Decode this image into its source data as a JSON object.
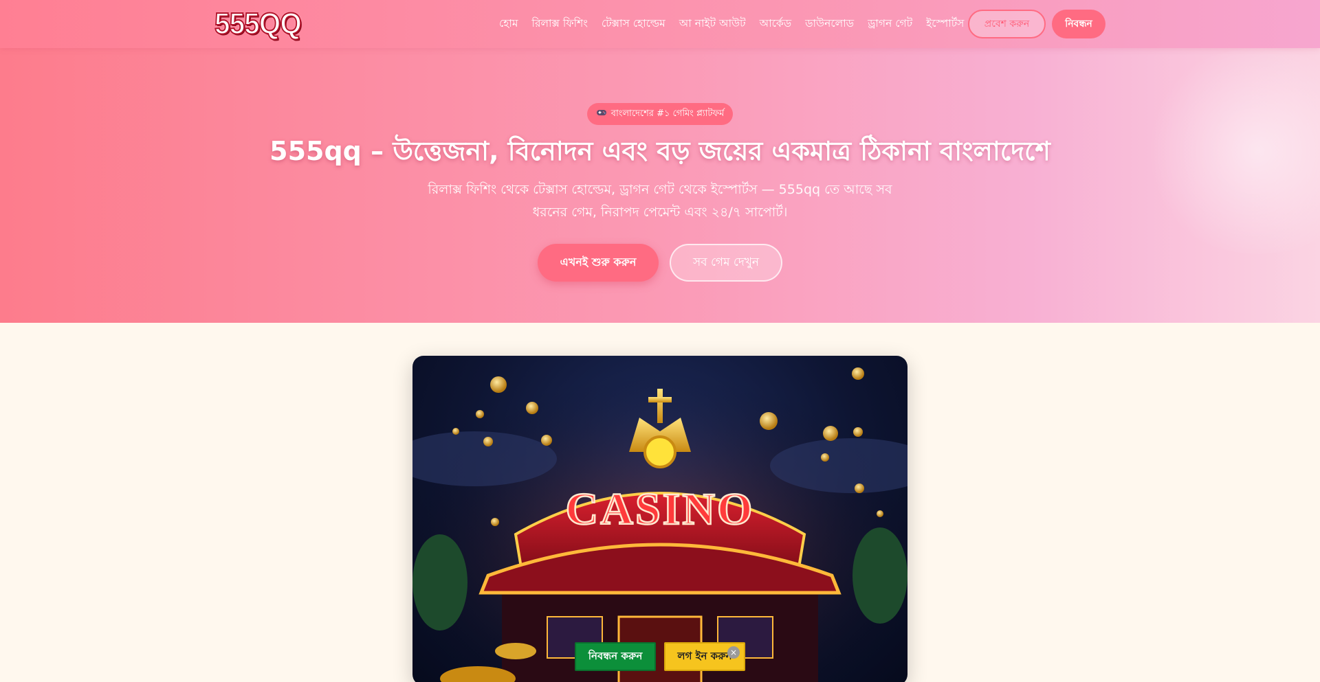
{
  "header": {
    "logo_text": "555QQ",
    "nav": [
      "হোম",
      "রিলাক্স ফিশিং",
      "টেক্সাস হোল্ডেম",
      "আ নাইট আউট",
      "আর্কেড",
      "ডাউনলোড",
      "ড্রাগন গেট",
      "ইস্পোর্টস"
    ],
    "login_label": "প্রবেশ করুন",
    "register_label": "নিবন্ধন"
  },
  "hero": {
    "badge_icon": "game-controller-icon",
    "badge_text": "বাংলাদেশের #১ গেমিং প্ল্যাটফর্ম",
    "title": "555qq – উত্তেজনা, বিনোদন এবং বড় জয়ের একমাত্র ঠিকানা বাংলাদেশে",
    "subtitle": "রিলাক্স ফিশিং থেকে টেক্সাস হোল্ডেম, ড্রাগন গেট থেকে ইস্পোর্টস — 555qq তে আছে সব ধরনের গেম, নিরাপদ পেমেন্ট এবং ২৪/৭ সাপোর্ট।",
    "cta_start": "এখনই শুরু করুন",
    "cta_all_games": "সব গেম দেখুন"
  },
  "hero_image": {
    "sign_text": "CASINO",
    "icon": "casino-illustration"
  },
  "sticky_bar": {
    "register_label": "নিবন্ধন করুন",
    "login_label": "লগ ইন করুন",
    "close_glyph": "×"
  },
  "colors": {
    "accent": "#ff6b82",
    "hero_start": "#fd7c8c",
    "hero_end": "#f8b0d3",
    "page_bg": "#fff8ee",
    "sticky_green": "#0c8f3a",
    "sticky_yellow": "#f6c41e"
  }
}
